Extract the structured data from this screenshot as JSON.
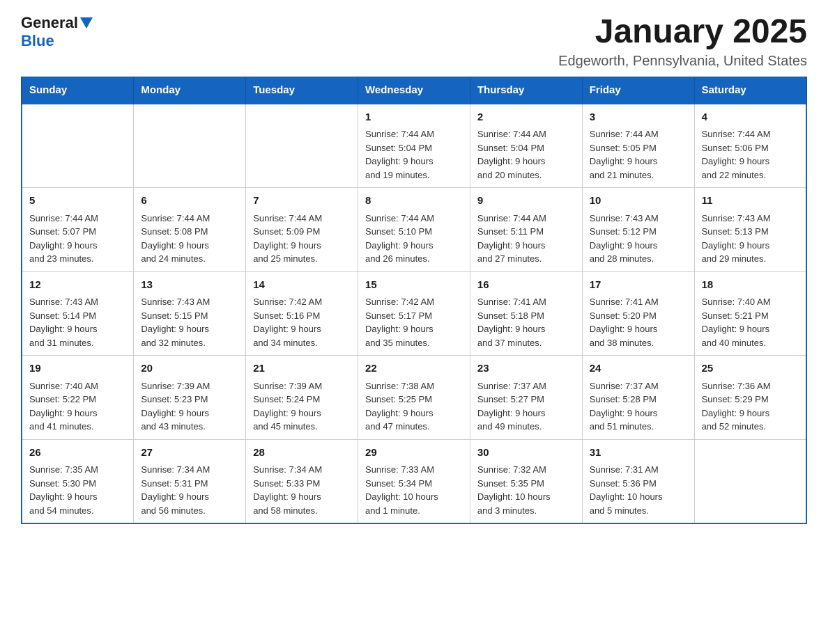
{
  "logo": {
    "text_general": "General",
    "text_blue": "Blue"
  },
  "title": "January 2025",
  "subtitle": "Edgeworth, Pennsylvania, United States",
  "weekdays": [
    "Sunday",
    "Monday",
    "Tuesday",
    "Wednesday",
    "Thursday",
    "Friday",
    "Saturday"
  ],
  "weeks": [
    [
      {
        "day": "",
        "info": ""
      },
      {
        "day": "",
        "info": ""
      },
      {
        "day": "",
        "info": ""
      },
      {
        "day": "1",
        "info": "Sunrise: 7:44 AM\nSunset: 5:04 PM\nDaylight: 9 hours\nand 19 minutes."
      },
      {
        "day": "2",
        "info": "Sunrise: 7:44 AM\nSunset: 5:04 PM\nDaylight: 9 hours\nand 20 minutes."
      },
      {
        "day": "3",
        "info": "Sunrise: 7:44 AM\nSunset: 5:05 PM\nDaylight: 9 hours\nand 21 minutes."
      },
      {
        "day": "4",
        "info": "Sunrise: 7:44 AM\nSunset: 5:06 PM\nDaylight: 9 hours\nand 22 minutes."
      }
    ],
    [
      {
        "day": "5",
        "info": "Sunrise: 7:44 AM\nSunset: 5:07 PM\nDaylight: 9 hours\nand 23 minutes."
      },
      {
        "day": "6",
        "info": "Sunrise: 7:44 AM\nSunset: 5:08 PM\nDaylight: 9 hours\nand 24 minutes."
      },
      {
        "day": "7",
        "info": "Sunrise: 7:44 AM\nSunset: 5:09 PM\nDaylight: 9 hours\nand 25 minutes."
      },
      {
        "day": "8",
        "info": "Sunrise: 7:44 AM\nSunset: 5:10 PM\nDaylight: 9 hours\nand 26 minutes."
      },
      {
        "day": "9",
        "info": "Sunrise: 7:44 AM\nSunset: 5:11 PM\nDaylight: 9 hours\nand 27 minutes."
      },
      {
        "day": "10",
        "info": "Sunrise: 7:43 AM\nSunset: 5:12 PM\nDaylight: 9 hours\nand 28 minutes."
      },
      {
        "day": "11",
        "info": "Sunrise: 7:43 AM\nSunset: 5:13 PM\nDaylight: 9 hours\nand 29 minutes."
      }
    ],
    [
      {
        "day": "12",
        "info": "Sunrise: 7:43 AM\nSunset: 5:14 PM\nDaylight: 9 hours\nand 31 minutes."
      },
      {
        "day": "13",
        "info": "Sunrise: 7:43 AM\nSunset: 5:15 PM\nDaylight: 9 hours\nand 32 minutes."
      },
      {
        "day": "14",
        "info": "Sunrise: 7:42 AM\nSunset: 5:16 PM\nDaylight: 9 hours\nand 34 minutes."
      },
      {
        "day": "15",
        "info": "Sunrise: 7:42 AM\nSunset: 5:17 PM\nDaylight: 9 hours\nand 35 minutes."
      },
      {
        "day": "16",
        "info": "Sunrise: 7:41 AM\nSunset: 5:18 PM\nDaylight: 9 hours\nand 37 minutes."
      },
      {
        "day": "17",
        "info": "Sunrise: 7:41 AM\nSunset: 5:20 PM\nDaylight: 9 hours\nand 38 minutes."
      },
      {
        "day": "18",
        "info": "Sunrise: 7:40 AM\nSunset: 5:21 PM\nDaylight: 9 hours\nand 40 minutes."
      }
    ],
    [
      {
        "day": "19",
        "info": "Sunrise: 7:40 AM\nSunset: 5:22 PM\nDaylight: 9 hours\nand 41 minutes."
      },
      {
        "day": "20",
        "info": "Sunrise: 7:39 AM\nSunset: 5:23 PM\nDaylight: 9 hours\nand 43 minutes."
      },
      {
        "day": "21",
        "info": "Sunrise: 7:39 AM\nSunset: 5:24 PM\nDaylight: 9 hours\nand 45 minutes."
      },
      {
        "day": "22",
        "info": "Sunrise: 7:38 AM\nSunset: 5:25 PM\nDaylight: 9 hours\nand 47 minutes."
      },
      {
        "day": "23",
        "info": "Sunrise: 7:37 AM\nSunset: 5:27 PM\nDaylight: 9 hours\nand 49 minutes."
      },
      {
        "day": "24",
        "info": "Sunrise: 7:37 AM\nSunset: 5:28 PM\nDaylight: 9 hours\nand 51 minutes."
      },
      {
        "day": "25",
        "info": "Sunrise: 7:36 AM\nSunset: 5:29 PM\nDaylight: 9 hours\nand 52 minutes."
      }
    ],
    [
      {
        "day": "26",
        "info": "Sunrise: 7:35 AM\nSunset: 5:30 PM\nDaylight: 9 hours\nand 54 minutes."
      },
      {
        "day": "27",
        "info": "Sunrise: 7:34 AM\nSunset: 5:31 PM\nDaylight: 9 hours\nand 56 minutes."
      },
      {
        "day": "28",
        "info": "Sunrise: 7:34 AM\nSunset: 5:33 PM\nDaylight: 9 hours\nand 58 minutes."
      },
      {
        "day": "29",
        "info": "Sunrise: 7:33 AM\nSunset: 5:34 PM\nDaylight: 10 hours\nand 1 minute."
      },
      {
        "day": "30",
        "info": "Sunrise: 7:32 AM\nSunset: 5:35 PM\nDaylight: 10 hours\nand 3 minutes."
      },
      {
        "day": "31",
        "info": "Sunrise: 7:31 AM\nSunset: 5:36 PM\nDaylight: 10 hours\nand 5 minutes."
      },
      {
        "day": "",
        "info": ""
      }
    ]
  ]
}
